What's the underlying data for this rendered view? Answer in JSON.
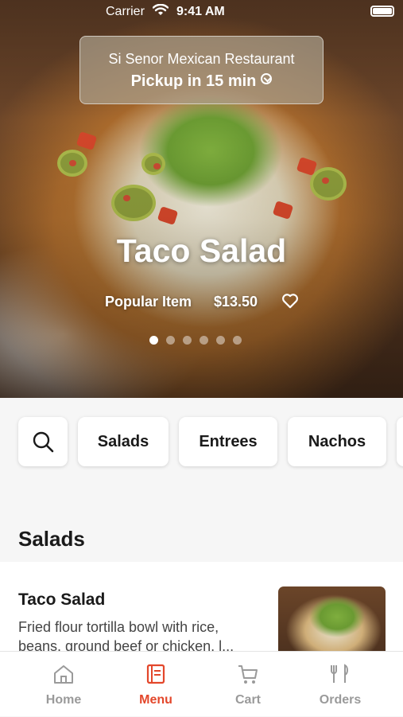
{
  "status_bar": {
    "carrier": "Carrier",
    "time": "9:41 AM"
  },
  "restaurant": {
    "name": "Si Senor Mexican Restaurant",
    "pickup": "Pickup in 15 min"
  },
  "featured": {
    "title": "Taco Salad",
    "tag": "Popular Item",
    "price": "$13.50",
    "carousel_pages": 6,
    "carousel_active": 1
  },
  "categories": {
    "items": [
      "Salads",
      "Entrees",
      "Nachos"
    ]
  },
  "section": {
    "title": "Salads",
    "items": [
      {
        "name": "Taco Salad",
        "description": "Fried flour tortilla bowl with rice, beans, ground beef or chicken, l..."
      }
    ]
  },
  "tabs": [
    {
      "label": "Home",
      "icon": "home-icon"
    },
    {
      "label": "Menu",
      "icon": "menu-icon",
      "active": true
    },
    {
      "label": "Cart",
      "icon": "cart-icon"
    },
    {
      "label": "Orders",
      "icon": "orders-icon"
    }
  ],
  "colors": {
    "accent": "#e3472b",
    "tab_inactive": "#9a9a9a"
  }
}
